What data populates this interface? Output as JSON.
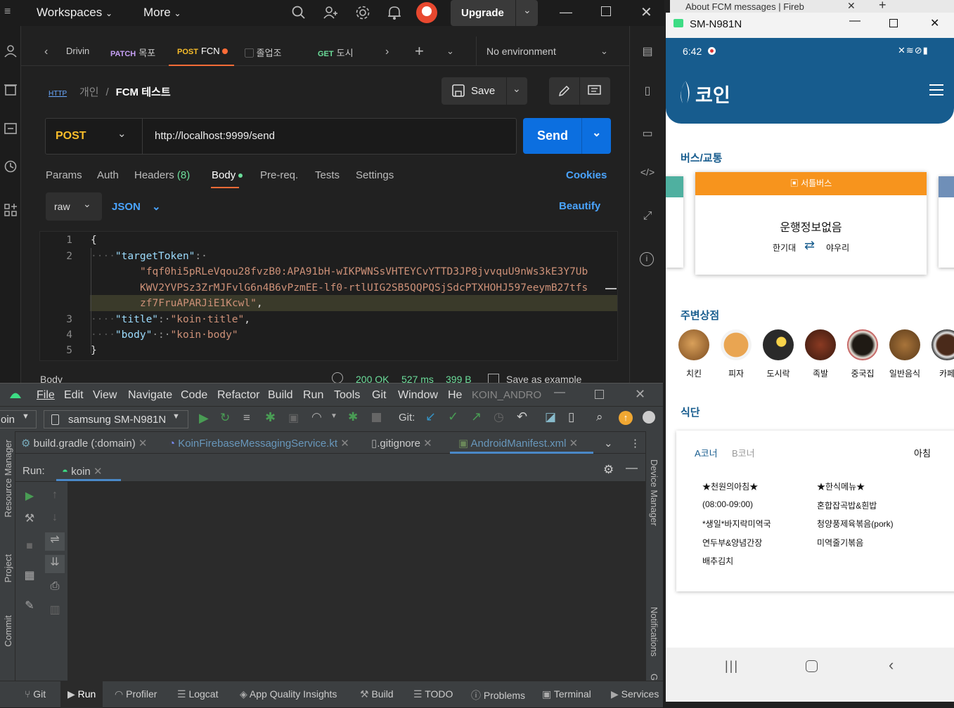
{
  "postman": {
    "top": {
      "workspaces": "Workspaces",
      "more": "More",
      "upgrade": "Upgrade"
    },
    "tabs": [
      {
        "label": "Drivin"
      },
      {
        "method": "PATCH",
        "label": "목포"
      },
      {
        "method": "POST",
        "label": "FCN"
      },
      {
        "label": "졸업조"
      },
      {
        "method": "GET",
        "label": "도시"
      }
    ],
    "environment": "No environment",
    "breadcrumb": {
      "http": "HTTP",
      "parent": "개인",
      "sep": "/",
      "title": "FCM 테스트"
    },
    "save_label": "Save",
    "method": "POST",
    "url": "http://localhost:9999/send",
    "send_label": "Send",
    "req_tabs": {
      "params": "Params",
      "auth": "Auth",
      "headers": "Headers",
      "headers_count": "(8)",
      "body": "Body",
      "prereq": "Pre-req.",
      "tests": "Tests",
      "settings": "Settings",
      "cookies": "Cookies"
    },
    "body_mode": "raw",
    "body_lang": "JSON",
    "beautify": "Beautify",
    "code_lines": [
      {
        "n": "1",
        "text": "{"
      },
      {
        "n": "2",
        "key": "\"targetToken\"",
        "rest": ":·"
      },
      {
        "n": "",
        "str": "\"fqf0hi5pRLeVqou28fvzB0:APA91bH-wIKPWNSsVHTEYCvYTTD3JP8jvvquU9nWs3kE3Y7Ub"
      },
      {
        "n": "",
        "str": "KWV2YVPSz3ZrMJFvlG6n4B6vPzmEE-lf0-rtlUIG2SB5QQPQSjSdcPTXHOHJ597eeymB27tfs"
      },
      {
        "n": "",
        "str": "zf7FruAPARJiE1Kcwl\"",
        "rest": ","
      },
      {
        "n": "3",
        "key": "\"title\"",
        "rest": ":·",
        "val": "\"koin·title\"",
        "end": ","
      },
      {
        "n": "4",
        "key": "\"body\"",
        "rest": "·:·",
        "val": "\"koin·body\""
      },
      {
        "n": "5",
        "text": "}"
      }
    ],
    "response": {
      "label": "Body",
      "status": "200 OK",
      "time": "527 ms",
      "size": "399 B",
      "save_example": "Save as example"
    }
  },
  "studio": {
    "menu": [
      "File",
      "Edit",
      "View",
      "Navigate",
      "Code",
      "Refactor",
      "Build",
      "Run",
      "Tools",
      "Git",
      "Window",
      "He"
    ],
    "project": "KOIN_ANDRO",
    "config": "oin",
    "device": "samsung SM-N981N",
    "git_label": "Git:",
    "file_tabs": [
      "build.gradle (:domain)",
      "KoinFirebaseMessagingService.kt",
      ".gitignore",
      "AndroidManifest.xml"
    ],
    "run_label": "Run:",
    "run_tab": "koin",
    "left_tools": [
      "Resource Manager",
      "Project",
      "Commit"
    ],
    "right_tools": [
      "Device Manager",
      "Notifications",
      "Gradle"
    ],
    "bottom_tools": [
      "Git",
      "Run",
      "Profiler",
      "Logcat",
      "App Quality Insights",
      "Build",
      "TODO",
      "Problems",
      "Terminal",
      "Services"
    ]
  },
  "phone": {
    "browser_tab": "About FCM messages | Fireb",
    "window_title": "SM-N981N",
    "time": "6:42",
    "app_logo": "코인",
    "bus_section": "버스/교통",
    "bus_card": {
      "header": "서틀버스",
      "status": "운행정보없음",
      "from": "한기대",
      "to": "야우리"
    },
    "shops_section": "주변상점",
    "shops": [
      "치킨",
      "피자",
      "도시락",
      "족발",
      "중국집",
      "일반음식",
      "카페"
    ],
    "meal_section": "식단",
    "meal": {
      "tab_a": "A코너",
      "tab_b": "B코너",
      "time": "아침",
      "col1": [
        "★천원의아침★",
        "(08:00-09:00)",
        "*생일*바지락미역국",
        "연두부&양념간장",
        "배추김치"
      ],
      "col2": [
        "★한식메뉴★",
        "혼합잡곡밥&흰밥",
        "청양풍제육볶음(pork)",
        "미역줄기볶음"
      ]
    }
  },
  "colors": {
    "accent": "#0c6fe0",
    "post": "#f8bd2a",
    "koin": "#175c8e",
    "shuttle": "#f7941d",
    "tab_dot": "#ff6c37",
    "json": "#4aa4ff"
  }
}
